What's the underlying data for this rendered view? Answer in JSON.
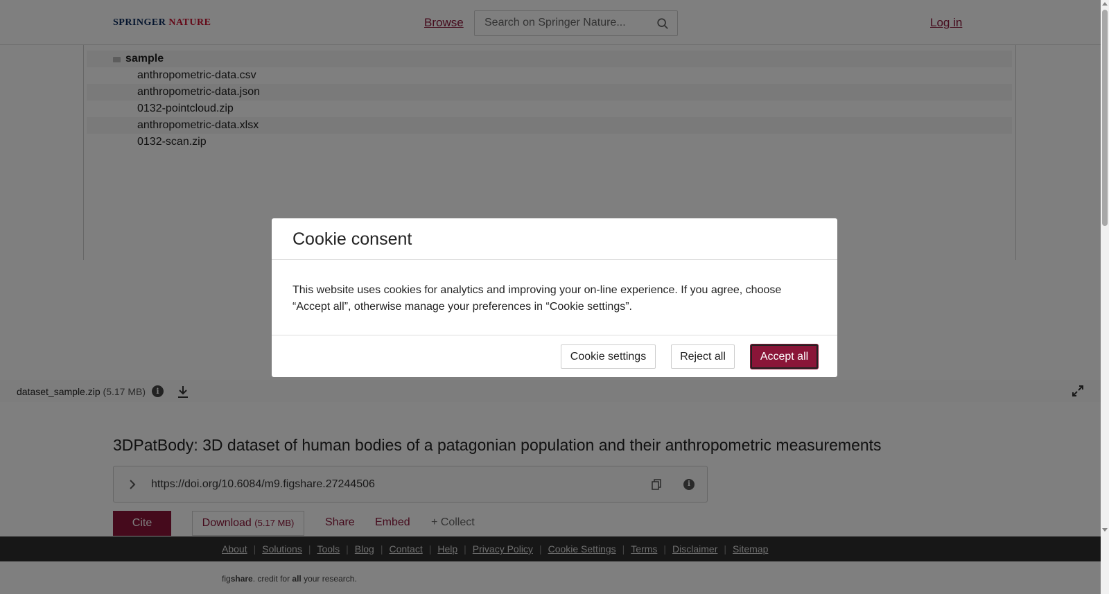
{
  "header": {
    "logo_part1": "SPRINGER",
    "logo_part2": " NATURE",
    "browse": "Browse",
    "search_placeholder": "Search on Springer Nature...",
    "login": "Log in"
  },
  "file_tree": {
    "folder": "sample",
    "files": [
      "anthropometric-data.csv",
      "anthropometric-data.json",
      "0132-pointcloud.zip",
      "anthropometric-data.xlsx",
      "0132-scan.zip"
    ]
  },
  "viewer_footer": {
    "file_name": "dataset_sample.zip",
    "file_size": "(5.17 MB)"
  },
  "article": {
    "title": "3DPatBody: 3D dataset of human bodies of a patagonian population and their anthropometric measurements",
    "doi": "https://doi.org/10.6084/m9.figshare.27244506",
    "cite": "Cite",
    "download": "Download",
    "download_size": "(5.17 MB)",
    "share": "Share",
    "embed": "Embed",
    "collect": "+ Collect"
  },
  "footer": {
    "links": [
      "About",
      "Solutions",
      "Tools",
      "Blog",
      "Contact",
      "Help",
      "Privacy Policy",
      "Cookie Settings",
      "Terms",
      "Disclaimer",
      "Sitemap"
    ],
    "tagline_pre": "fig",
    "tagline_bold": "share",
    "tagline_mid": ". credit for ",
    "tagline_bold2": "all",
    "tagline_end": " your research."
  },
  "cookie_modal": {
    "title": "Cookie consent",
    "body": "This website uses cookies for analytics and improving your on-line experience. If you agree, choose “Accept all”, otherwise manage your preferences in “Cookie settings”.",
    "settings_button": "Cookie settings",
    "reject_button": "Reject all",
    "accept_button": "Accept all"
  },
  "colors": {
    "brand": "#8a1538",
    "footer_bg": "#2e2e2e"
  }
}
